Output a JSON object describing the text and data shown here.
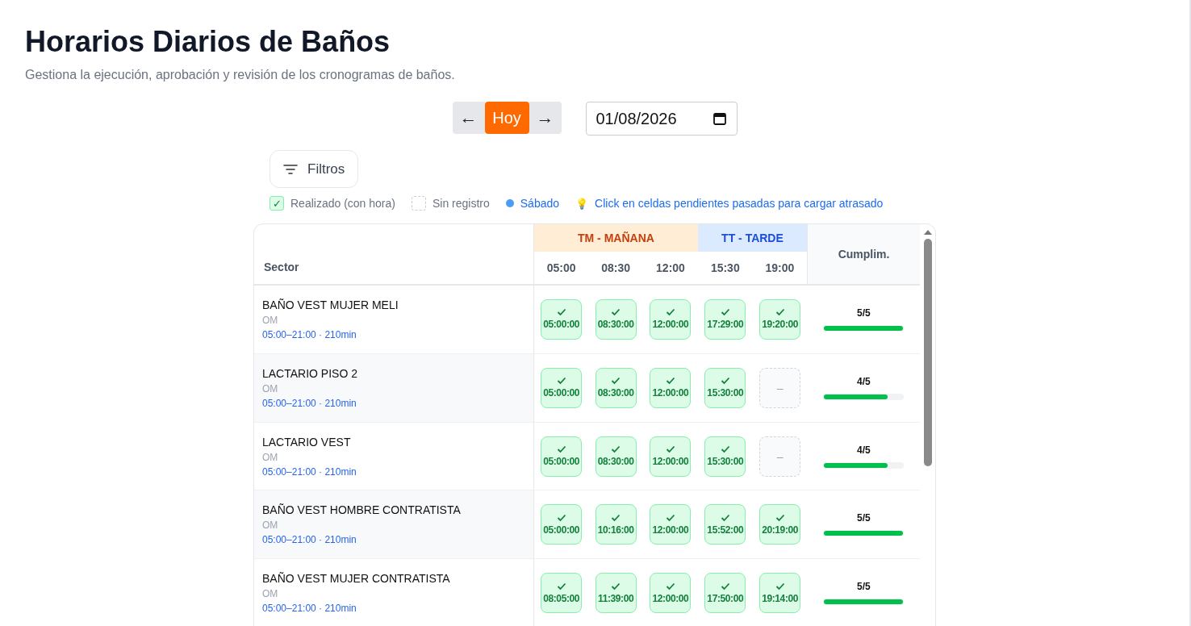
{
  "title": "Horarios Diarios de Baños",
  "subtitle": "Gestiona la ejecución, aprobación y revisión de los cronogramas de baños.",
  "nav": {
    "prev": "←",
    "today": "Hoy",
    "next": "→",
    "date": "01/08/2026"
  },
  "filters_button": "Filtros",
  "legend": [
    {
      "kind": "done",
      "label": "Realizado (con hora)",
      "mark": "✓"
    },
    {
      "kind": "empty",
      "label": "Sin registro"
    },
    {
      "kind": "dot",
      "label": "Sábado",
      "color": "#4b9cf5"
    },
    {
      "kind": "tip",
      "label": "Click en celdas pendientes pasadas para cargar atrasado",
      "mark": "💡"
    }
  ],
  "table": {
    "sector_header": "Sector",
    "compliance_header": "Cumplim.",
    "shifts": [
      {
        "kind": "morning",
        "label": "TM - MAÑANA",
        "times": [
          "05:00",
          "08:30",
          "12:00"
        ]
      },
      {
        "kind": "afternoon",
        "label": "TT - TARDE",
        "times": [
          "15:30",
          "19:00"
        ]
      }
    ],
    "rows": [
      {
        "name": "BAÑO VEST MUJER MELI",
        "group": "OM",
        "schedule": "05:00–21:00 · 210min",
        "cells": [
          {
            "kind": "done",
            "text": "05:00:00"
          },
          {
            "kind": "done",
            "text": "08:30:00"
          },
          {
            "kind": "done",
            "text": "12:00:00"
          },
          {
            "kind": "done",
            "text": "17:29:00"
          },
          {
            "kind": "done",
            "text": "19:20:00"
          }
        ],
        "score": "5/5",
        "level": 1
      },
      {
        "name": "LACTARIO PISO 2",
        "group": "OM",
        "schedule": "05:00–21:00 · 210min",
        "cells": [
          {
            "kind": "done",
            "text": "05:00:00"
          },
          {
            "kind": "done",
            "text": "08:30:00"
          },
          {
            "kind": "done",
            "text": "12:00:00"
          },
          {
            "kind": "done",
            "text": "15:30:00"
          },
          {
            "kind": "empty",
            "text": "–"
          }
        ],
        "score": "4/5",
        "level": 0.8
      },
      {
        "name": "LACTARIO VEST",
        "group": "OM",
        "schedule": "05:00–21:00 · 210min",
        "cells": [
          {
            "kind": "done",
            "text": "05:00:00"
          },
          {
            "kind": "done",
            "text": "08:30:00"
          },
          {
            "kind": "done",
            "text": "12:00:00"
          },
          {
            "kind": "done",
            "text": "15:30:00"
          },
          {
            "kind": "empty",
            "text": "–"
          }
        ],
        "score": "4/5",
        "level": 0.8
      },
      {
        "name": "BAÑO VEST HOMBRE CONTRATISTA",
        "group": "OM",
        "schedule": "05:00–21:00 · 210min",
        "cells": [
          {
            "kind": "done",
            "text": "05:00:00"
          },
          {
            "kind": "done",
            "text": "10:16:00"
          },
          {
            "kind": "done",
            "text": "12:00:00"
          },
          {
            "kind": "done",
            "text": "15:52:00"
          },
          {
            "kind": "done",
            "text": "20:19:00"
          }
        ],
        "score": "5/5",
        "level": 1
      },
      {
        "name": "BAÑO VEST MUJER CONTRATISTA",
        "group": "OM",
        "schedule": "05:00–21:00 · 210min",
        "cells": [
          {
            "kind": "done",
            "text": "08:05:00"
          },
          {
            "kind": "done",
            "text": "11:39:00"
          },
          {
            "kind": "done",
            "text": "12:00:00"
          },
          {
            "kind": "done",
            "text": "17:50:00"
          },
          {
            "kind": "done",
            "text": "19:14:00"
          }
        ],
        "score": "5/5",
        "level": 1
      }
    ]
  }
}
